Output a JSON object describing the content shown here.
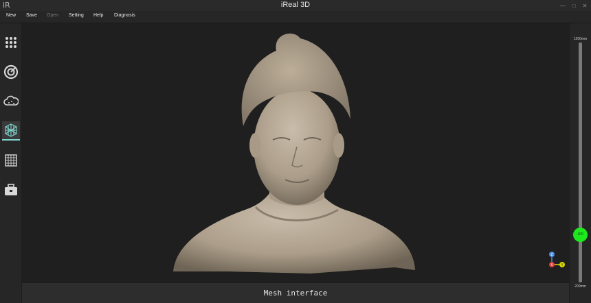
{
  "window": {
    "logo": "iR",
    "title": "iReal 3D",
    "controls": [
      "—",
      "□",
      "✕"
    ]
  },
  "menu": [
    {
      "label": "New",
      "enabled": true
    },
    {
      "label": "Save",
      "enabled": true
    },
    {
      "label": "Open",
      "enabled": false
    },
    {
      "label": "Setting",
      "enabled": true
    },
    {
      "label": "Help",
      "enabled": true
    },
    {
      "label": "Diagnosis",
      "enabled": true
    }
  ],
  "sidebar": {
    "items": [
      {
        "icon": "dots-grid-icon",
        "active": false
      },
      {
        "icon": "turntable-scan-icon",
        "active": false
      },
      {
        "icon": "point-cloud-icon",
        "active": false
      },
      {
        "icon": "mesh-cube-icon",
        "active": true
      },
      {
        "icon": "texture-grid-icon",
        "active": false
      },
      {
        "icon": "toolbox-icon",
        "active": false
      }
    ]
  },
  "viewport": {
    "content": "3D mesh model of a human bust"
  },
  "status": {
    "text": "Mesh interface"
  },
  "depth_slider": {
    "max_label": "1200mm",
    "min_label": "200mm",
    "value_label": "400",
    "value_fraction": 0.2
  },
  "axis": {
    "z": "Z",
    "x": "X",
    "y": "Y"
  },
  "colors": {
    "accent": "#7fd6d0",
    "slider_thumb": "#1ee81e",
    "mesh": "#b8ab98"
  }
}
